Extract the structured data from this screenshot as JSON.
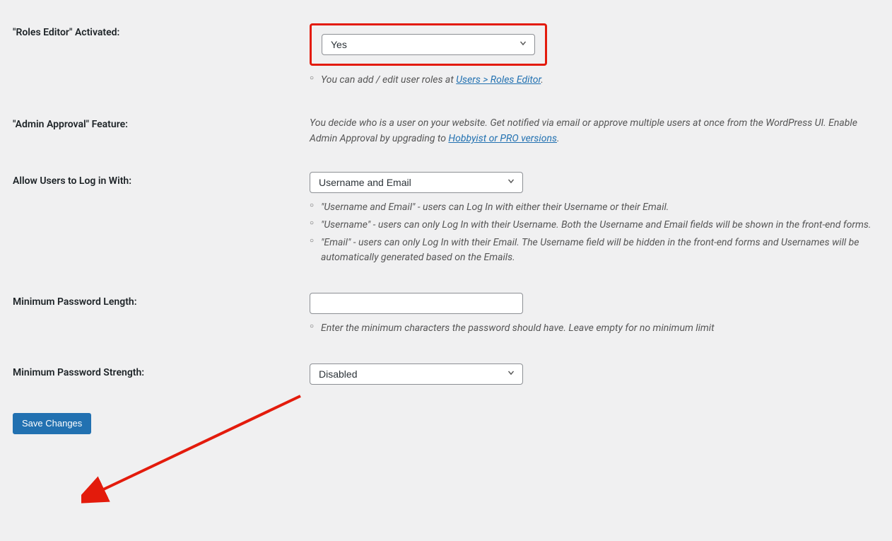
{
  "rows": {
    "roles_editor": {
      "label": "\"Roles Editor\" Activated:",
      "select_value": "Yes",
      "hint_prefix": "You can add / edit user roles at ",
      "hint_link": "Users > Roles Editor",
      "hint_suffix": "."
    },
    "admin_approval": {
      "label": "\"Admin Approval\" Feature:",
      "desc_prefix": "You decide who is a user on your website. Get notified via email or approve multiple users at once from the WordPress UI. Enable Admin Approval by upgrading to ",
      "desc_link": "Hobbyist or PRO versions",
      "desc_suffix": "."
    },
    "login_with": {
      "label": "Allow Users to Log in With:",
      "select_value": "Username and Email",
      "hints": [
        "\"Username and Email\" - users can Log In with either their Username or their Email.",
        "\"Username\" - users can only Log In with their Username. Both the Username and Email fields will be shown in the front-end forms.",
        "\"Email\" - users can only Log In with their Email. The Username field will be hidden in the front-end forms and Usernames will be automatically generated based on the Emails."
      ]
    },
    "min_pw_length": {
      "label": "Minimum Password Length:",
      "value": "",
      "hint": "Enter the minimum characters the password should have. Leave empty for no minimum limit"
    },
    "min_pw_strength": {
      "label": "Minimum Password Strength:",
      "select_value": "Disabled"
    }
  },
  "save_button": "Save Changes"
}
